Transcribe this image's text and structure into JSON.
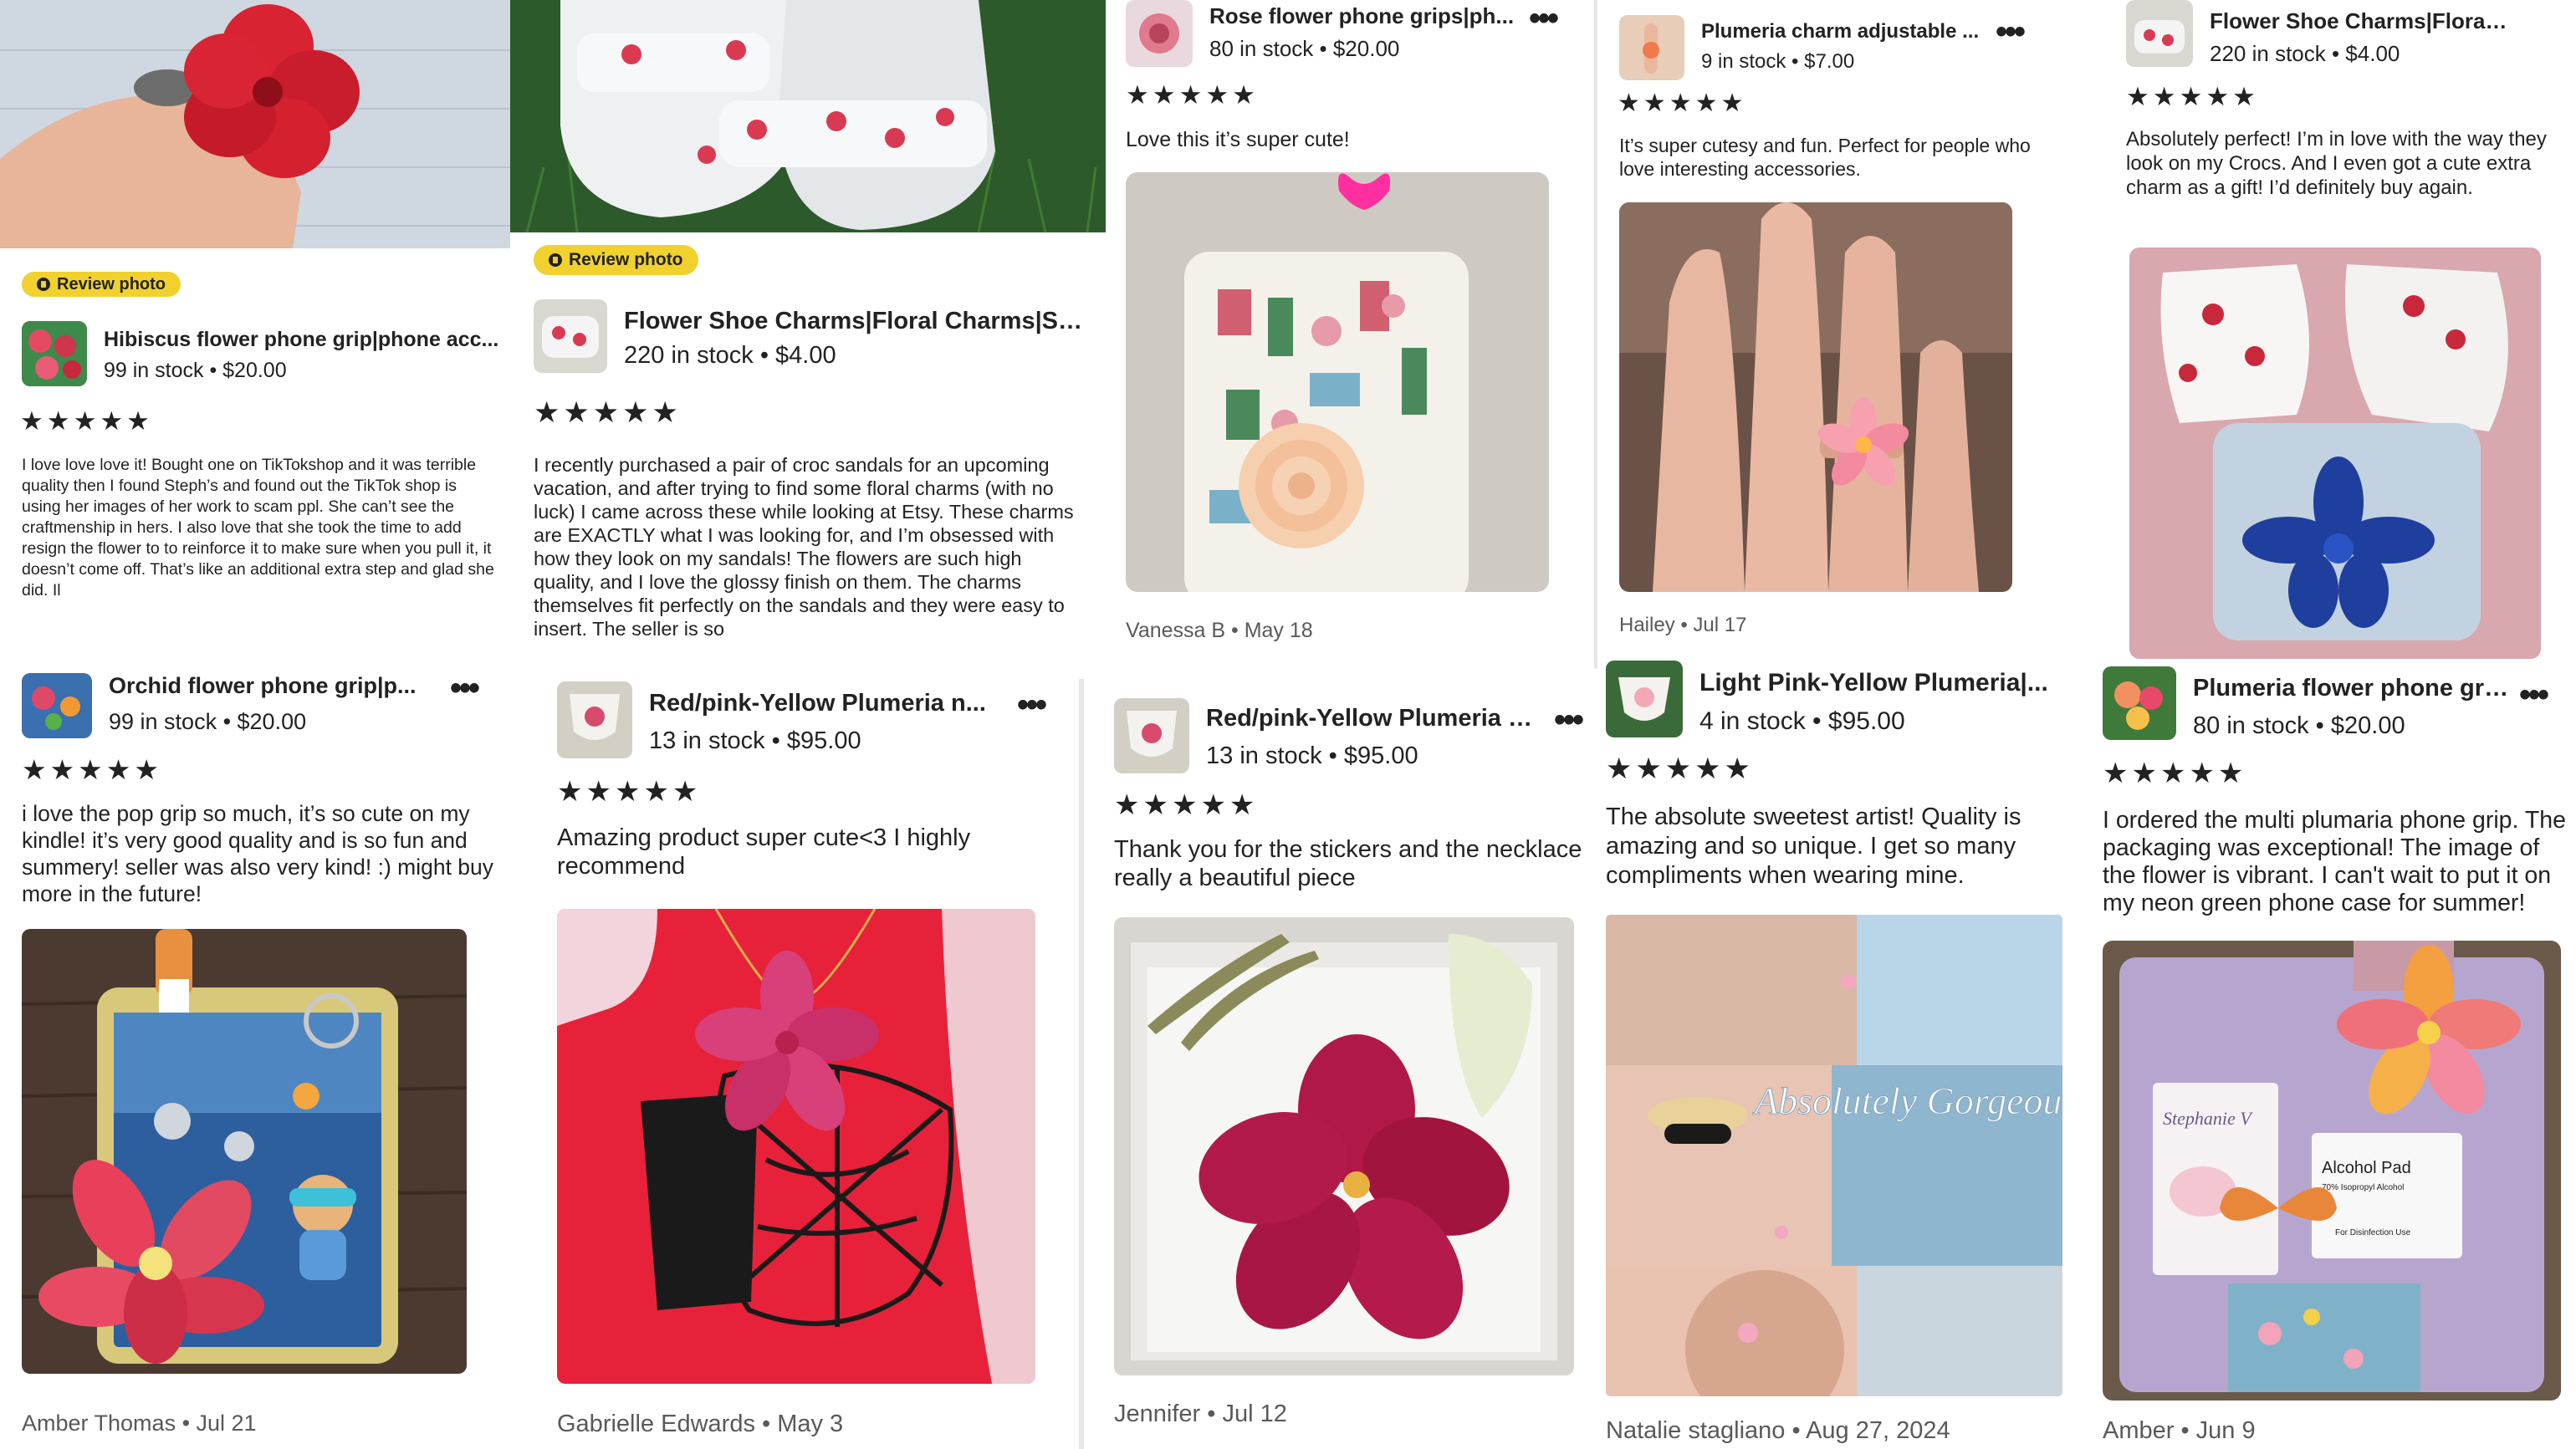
{
  "labels": {
    "review_photo": "Review photo",
    "more": "•••",
    "stars": "★★★★★"
  },
  "reviews": [
    {
      "product_title": "Hibiscus flower phone grip|phone acc...",
      "stock_price": "99 in stock • $20.00",
      "text": "I love love love it! Bought one on TikTokshop and it was terrible quality then I found Steph’s and found out the TikTok shop is using her images of her work to scam ppl. She can’t see the craftmenship in hers. I also love that she took the time to add resign the flower to  to reinforce it to make sure when you pull it, it doesn’t come off. That’s like an additional extra step and glad she did. Il",
      "author_date": ""
    },
    {
      "product_title": "Flower Shoe Charms|Floral Charms|Sh...",
      "stock_price": "220 in stock • $4.00",
      "text": "I recently purchased a pair of croc sandals for an upcoming vacation, and after trying to find some floral charms (with no luck) I came across these while looking at Etsy. These charms are EXACTLY what I was looking for, and I’m obsessed with how they look on my sandals! The flowers are such high quality, and I love the glossy finish on them. The charms themselves fit perfectly on the sandals and they were easy to insert. The seller is so",
      "author_date": ""
    },
    {
      "product_title": "Rose flower phone grips|ph...",
      "stock_price": "80 in stock • $20.00",
      "text": "Love this it’s super cute!",
      "author_date": "Vanessa B • May 18"
    },
    {
      "product_title": "Plumeria charm adjustable ...",
      "stock_price": "9 in stock • $7.00",
      "text": "It’s super cutesy and fun. Perfect for people who love interesting accessories.",
      "author_date": "Hailey • Jul 17"
    },
    {
      "product_title": "Flower Shoe Charms|Floral ...",
      "stock_price": "220 in stock • $4.00",
      "text": "Absolutely perfect! I’m in love with the way they look on my Crocs. And I even got a cute extra charm as a gift! I’d definitely buy again.",
      "author_date": ""
    },
    {
      "product_title": "Orchid flower phone grip|p...",
      "stock_price": "99 in stock • $20.00",
      "text": "i love the pop grip so much, it’s so cute on my kindle! it’s very good quality and is so fun and summery! seller was also very kind! :) might buy more in the future!",
      "author_date": "Amber Thomas • Jul 21"
    },
    {
      "product_title": "Red/pink-Yellow Plumeria n...",
      "stock_price": "13 in stock • $95.00",
      "text": "Amazing product super cute<3 I highly recommend",
      "author_date": "Gabrielle Edwards • May 3"
    },
    {
      "product_title": "Red/pink-Yellow Plumeria n...",
      "stock_price": "13 in stock • $95.00",
      "text": "Thank you for the stickers and the necklace really a beautiful piece",
      "author_date": "Jennifer • Jul 12"
    },
    {
      "product_title": "Light Pink-Yellow Plumeria|...",
      "stock_price": "4 in stock • $95.00",
      "text": "The absolute sweetest artist! Quality is amazing and so unique. I get so many compliments when wearing mine.",
      "author_date": "Natalie stagliano • Aug 27, 2024",
      "photo_overlay": "Absolutely Gorgeous"
    },
    {
      "product_title": "Plumeria flower phone grip...",
      "stock_price": "80 in stock • $20.00",
      "text": "I ordered the multi plumaria phone grip. The packaging was exceptional! The image of the flower is vibrant. I can't wait to put it on my neon green phone case for summer!",
      "author_date": "Amber • Jun 9",
      "photo_labels": {
        "alcohol": "Alcohol Pad",
        "alcohol_sub": "70% Isopropyl Alcohol",
        "alcohol_use": "For Disinfection Use",
        "signature": "Stephanie V"
      }
    }
  ],
  "colors": {
    "star": "#222222",
    "badge": "#f1d12e",
    "muted": "#595959"
  }
}
